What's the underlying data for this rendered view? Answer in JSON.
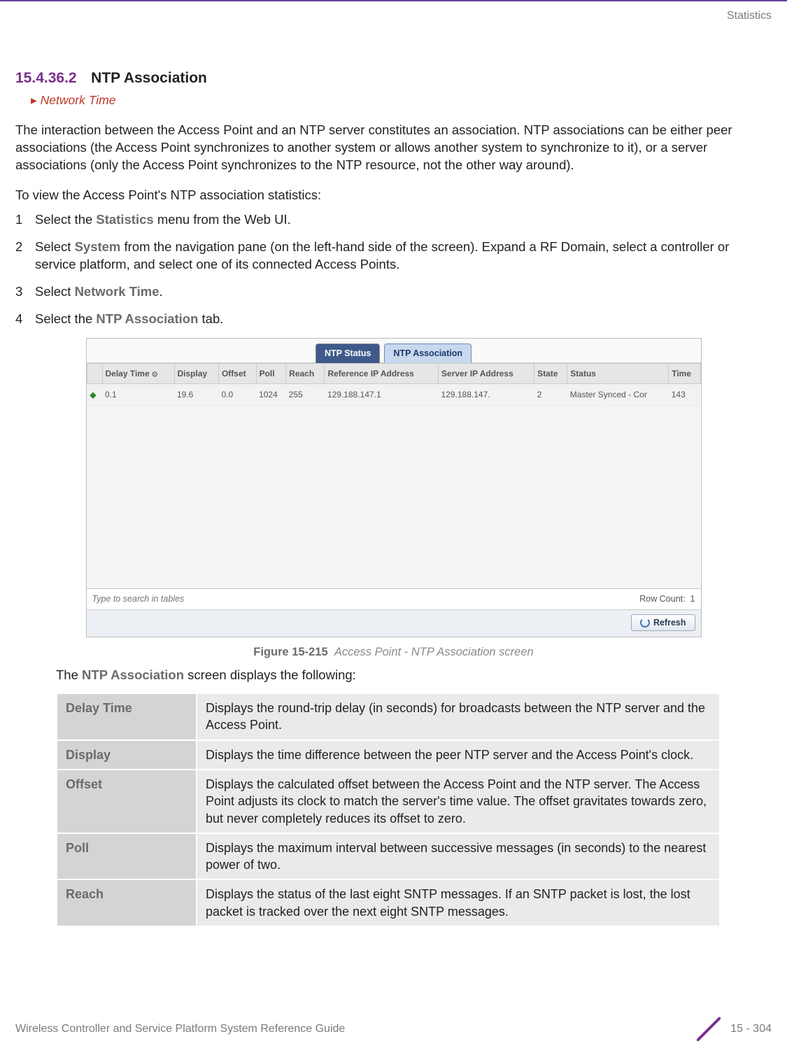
{
  "header": {
    "category": "Statistics"
  },
  "section": {
    "number": "15.4.36.2",
    "title": "NTP Association",
    "breadcrumb_arrow": "▸",
    "breadcrumb": "Network Time"
  },
  "intro": "The interaction between the Access Point and an NTP server constitutes an association. NTP associations can be either peer associations (the Access Point synchronizes to another system or allows another system to synchronize to it), or a server associations (only the Access Point synchronizes to the NTP resource, not the other way around).",
  "lead": "To view the Access Point's NTP association statistics:",
  "steps": [
    {
      "n": "1",
      "pre": "Select the ",
      "kw": "Statistics",
      "post": " menu from the Web UI."
    },
    {
      "n": "2",
      "pre": "Select ",
      "kw": "System",
      "post": " from the navigation pane (on the left-hand side of the screen). Expand a RF Domain, select a controller or service platform, and select one of its connected Access Points."
    },
    {
      "n": "3",
      "pre": "Select ",
      "kw": "Network Time",
      "post": "."
    },
    {
      "n": "4",
      "pre": "Select the ",
      "kw": "NTP Association",
      "post": " tab."
    }
  ],
  "screenshot": {
    "tabs": {
      "inactive": "NTP Status",
      "active": "NTP Association"
    },
    "columns": [
      "Delay Time",
      "Display",
      "Offset",
      "Poll",
      "Reach",
      "Reference IP Address",
      "Server IP Address",
      "State",
      "Status",
      "Time"
    ],
    "sort_indicator": "⊙",
    "row": {
      "marker": "⬥",
      "delay_time": "0.1",
      "display": "19.6",
      "offset": "0.0",
      "poll": "1024",
      "reach": "255",
      "ref_ip": "129.188.147.1",
      "server_ip": "129.188.147.",
      "state": "2",
      "status": "Master Synced - Cor",
      "time": "143"
    },
    "search_placeholder": "Type to search in tables",
    "row_count_label": "Row Count:",
    "row_count_value": "1",
    "refresh": "Refresh"
  },
  "figure": {
    "label": "Figure 15-215",
    "desc": "Access Point - NTP Association screen"
  },
  "post_figure": {
    "pre": "The ",
    "kw": "NTP Association",
    "post": " screen displays the following:"
  },
  "desc_table": [
    {
      "key": "Delay Time",
      "val": "Displays the round-trip delay (in seconds) for broadcasts between the NTP server and the Access Point."
    },
    {
      "key": "Display",
      "val": "Displays the time difference between the peer NTP server and the Access Point's clock."
    },
    {
      "key": "Offset",
      "val": "Displays the calculated offset between the Access Point and the NTP server. The Access Point adjusts its clock to match the server's time value. The offset gravitates towards zero, but never completely reduces its offset to zero."
    },
    {
      "key": "Poll",
      "val": "Displays the maximum interval between successive messages (in seconds) to the nearest power of two."
    },
    {
      "key": "Reach",
      "val": "Displays the status of the last eight SNTP messages. If an SNTP packet is lost, the lost packet is tracked over the next eight SNTP messages."
    }
  ],
  "footer": {
    "left": "Wireless Controller and Service Platform System Reference Guide",
    "right": "15 - 304"
  }
}
